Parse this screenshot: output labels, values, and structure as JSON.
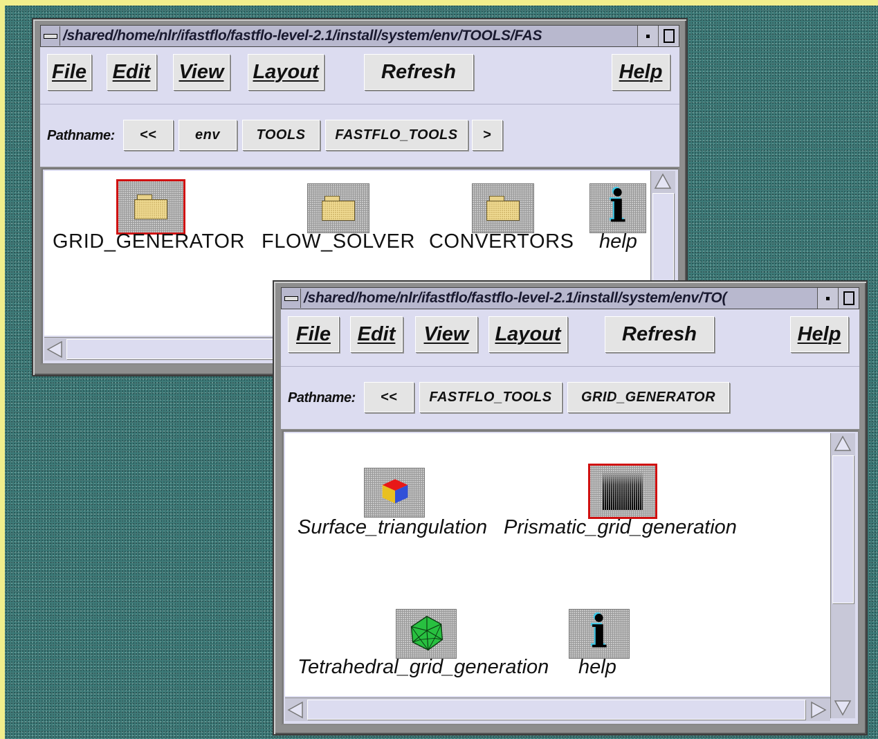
{
  "window1": {
    "title": "/shared/home/nlr/ifastflo/fastflo-level-2.1/install/system/env/TOOLS/FAS",
    "menu": {
      "file": "File",
      "edit": "Edit",
      "view": "View",
      "layout": "Layout",
      "refresh": "Refresh",
      "help": "Help"
    },
    "path": {
      "label": "Pathname:",
      "back": "<<",
      "segments": [
        "env",
        "TOOLS",
        "FASTFLO_TOOLS"
      ],
      "forward": ">"
    },
    "items": [
      {
        "label": "GRID_GENERATOR",
        "icon": "folder-icon",
        "selected": true
      },
      {
        "label": "FLOW_SOLVER",
        "icon": "folder-icon",
        "selected": false
      },
      {
        "label": "CONVERTORS",
        "icon": "folder-icon",
        "selected": false
      },
      {
        "label": "help",
        "icon": "info-icon",
        "selected": false
      }
    ]
  },
  "window2": {
    "title": "/shared/home/nlr/ifastflo/fastflo-level-2.1/install/system/env/TO(",
    "menu": {
      "file": "File",
      "edit": "Edit",
      "view": "View",
      "layout": "Layout",
      "refresh": "Refresh",
      "help": "Help"
    },
    "path": {
      "label": "Pathname:",
      "back": "<<",
      "segments": [
        "FASTFLO_TOOLS",
        "GRID_GENERATOR"
      ]
    },
    "items": [
      {
        "label": "Surface_triangulation",
        "icon": "colored-cube-icon",
        "selected": false
      },
      {
        "label": "Prismatic_grid_generation",
        "icon": "prismatic-grid-icon",
        "selected": true
      },
      {
        "label": "Tetrahedral_grid_generation",
        "icon": "green-polyhedron-icon",
        "selected": false
      },
      {
        "label": "help",
        "icon": "info-icon",
        "selected": false
      }
    ]
  },
  "colors": {
    "desktop": "#3d7a78",
    "panel": "#dcdcf0",
    "selection_border": "#d01010",
    "title_bar": "#b8b8ce"
  }
}
